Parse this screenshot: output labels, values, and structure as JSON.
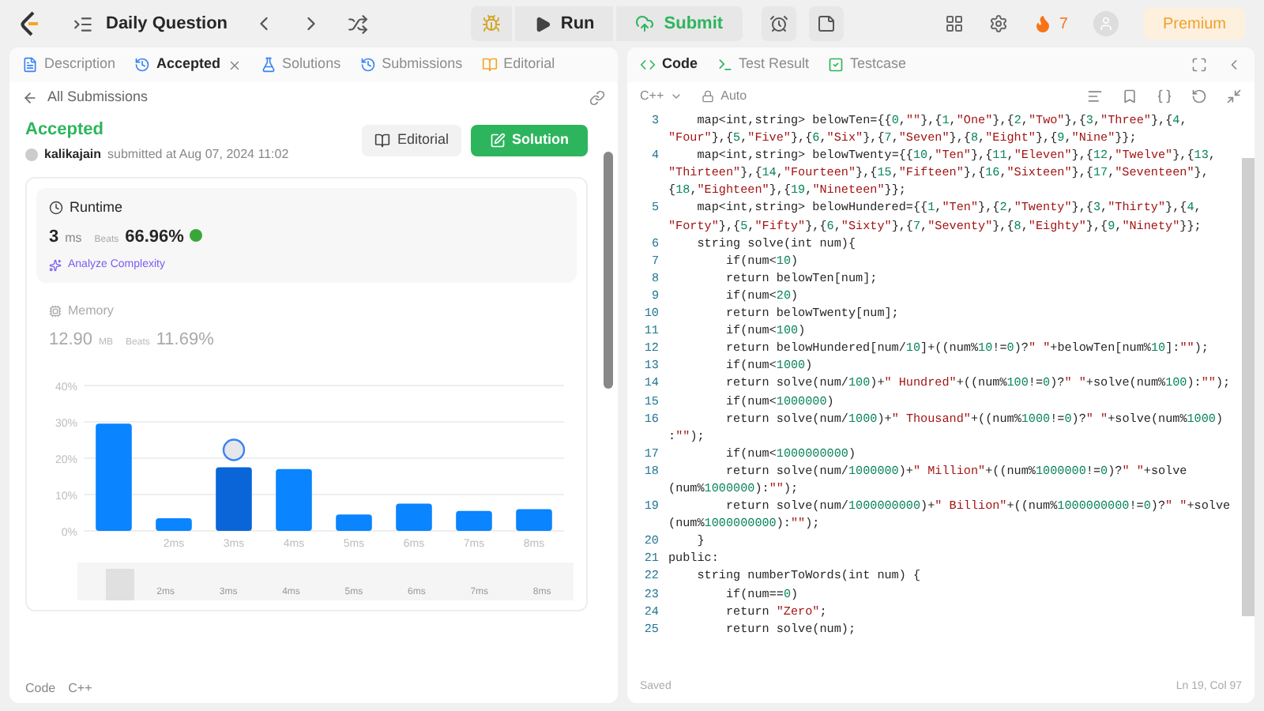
{
  "topbar": {
    "title": "Daily Question",
    "run": "Run",
    "submit": "Submit",
    "streak": "7",
    "premium": "Premium"
  },
  "left_tabs": [
    {
      "label": "Description",
      "selected": false,
      "closable": false
    },
    {
      "label": "Accepted",
      "selected": true,
      "closable": true
    },
    {
      "label": "Solutions",
      "selected": false,
      "closable": false
    },
    {
      "label": "Submissions",
      "selected": false,
      "closable": false
    },
    {
      "label": "Editorial",
      "selected": false,
      "closable": false
    }
  ],
  "submission": {
    "back": "All Submissions",
    "status": "Accepted",
    "user": "kalikajain",
    "submitted": "submitted at Aug 07, 2024 11:02",
    "editorial": "Editorial",
    "solution": "Solution",
    "runtime": {
      "title": "Runtime",
      "value": "3",
      "unit": "ms",
      "beats_label": "Beats",
      "beats": "66.96%",
      "analyze": "Analyze Complexity"
    },
    "memory": {
      "title": "Memory",
      "value": "12.90",
      "unit": "MB",
      "beats_label": "Beats",
      "beats": "11.69%"
    },
    "chart_data": {
      "type": "bar",
      "categories": [
        null,
        "2ms",
        "3ms",
        "4ms",
        "5ms",
        "6ms",
        "7ms",
        "8ms"
      ],
      "values": [
        29.5,
        3.5,
        17.5,
        17,
        4.5,
        7.5,
        5.5,
        6
      ],
      "ylim": [
        0,
        40
      ],
      "yticks": [
        {
          "value": 0,
          "label": "0%"
        },
        {
          "value": 10,
          "label": "10%"
        },
        {
          "value": 20,
          "label": "20%"
        },
        {
          "value": 30,
          "label": "30%"
        },
        {
          "value": 40,
          "label": "40%"
        }
      ],
      "grid": true,
      "annotations": [
        {
          "x": "3ms"
        }
      ]
    },
    "navigator_labels": [
      "2ms",
      "3ms",
      "4ms",
      "5ms",
      "6ms",
      "7ms",
      "8ms"
    ],
    "code_label": "Code",
    "code_lang": "C++"
  },
  "right_tabs": [
    {
      "label": "Code",
      "selected": true
    },
    {
      "label": "Test Result",
      "selected": false
    },
    {
      "label": "Testcase",
      "selected": false
    }
  ],
  "editor": {
    "language": "C++",
    "mode": "Auto",
    "saved": "Saved",
    "position": "Ln 19, Col 97",
    "lines": [
      {
        "number": "3",
        "rows": [
          "    map<int,string> belowTen={{0,\"\"},{1,\"One\"},{2,\"Two\"},{3,\"Three\"},{4,",
          "\"Four\"},{5,\"Five\"},{6,\"Six\"},{7,\"Seven\"},{8,\"Eight\"},{9,\"Nine\"}};"
        ]
      },
      {
        "number": "4",
        "rows": [
          "    map<int,string> belowTwenty={{10,\"Ten\"},{11,\"Eleven\"},{12,\"Twelve\"},{13,",
          "\"Thirteen\"},{14,\"Fourteen\"},{15,\"Fifteen\"},{16,\"Sixteen\"},{17,\"Seventeen\"},",
          "{18,\"Eighteen\"},{19,\"Nineteen\"}};"
        ]
      },
      {
        "number": "5",
        "rows": [
          "    map<int,string> belowHundered={{1,\"Ten\"},{2,\"Twenty\"},{3,\"Thirty\"},{4,",
          "\"Forty\"},{5,\"Fifty\"},{6,\"Sixty\"},{7,\"Seventy\"},{8,\"Eighty\"},{9,\"Ninety\"}};"
        ]
      },
      {
        "number": "6",
        "rows": [
          "    string solve(int num){"
        ]
      },
      {
        "number": "7",
        "rows": [
          "        if(num<10)"
        ]
      },
      {
        "number": "8",
        "rows": [
          "        return belowTen[num];"
        ]
      },
      {
        "number": "9",
        "rows": [
          "        if(num<20)"
        ]
      },
      {
        "number": "10",
        "rows": [
          "        return belowTwenty[num];"
        ]
      },
      {
        "number": "11",
        "rows": [
          "        if(num<100)"
        ]
      },
      {
        "number": "12",
        "rows": [
          "        return belowHundered[num/10]+((num%10!=0)?\" \"+belowTen[num%10]:\"\");"
        ]
      },
      {
        "number": "13",
        "rows": [
          "        if(num<1000)"
        ]
      },
      {
        "number": "14",
        "rows": [
          "        return solve(num/100)+\" Hundred\"+((num%100!=0)?\" \"+solve(num%100):\"\");"
        ]
      },
      {
        "number": "15",
        "rows": [
          "        if(num<1000000)"
        ]
      },
      {
        "number": "16",
        "rows": [
          "        return solve(num/1000)+\" Thousand\"+((num%1000!=0)?\" \"+solve(num%1000)",
          ":\"\");"
        ]
      },
      {
        "number": "17",
        "rows": [
          "        if(num<1000000000)"
        ]
      },
      {
        "number": "18",
        "rows": [
          "        return solve(num/1000000)+\" Million\"+((num%1000000!=0)?\" \"+solve",
          "(num%1000000):\"\");"
        ]
      },
      {
        "number": "19",
        "rows": [
          "        return solve(num/1000000000)+\" Billion\"+((num%1000000000!=0)?\" \"+solve",
          "(num%1000000000):\"\");"
        ]
      },
      {
        "number": "20",
        "rows": [
          "    }"
        ]
      },
      {
        "number": "21",
        "rows": [
          "public:"
        ]
      },
      {
        "number": "22",
        "rows": [
          "    string numberToWords(int num) {"
        ]
      },
      {
        "number": "23",
        "rows": [
          "        if(num==0)"
        ]
      },
      {
        "number": "24",
        "rows": [
          "        return \"Zero\";"
        ]
      },
      {
        "number": "25",
        "rows": [
          "        return solve(num);"
        ]
      }
    ]
  }
}
